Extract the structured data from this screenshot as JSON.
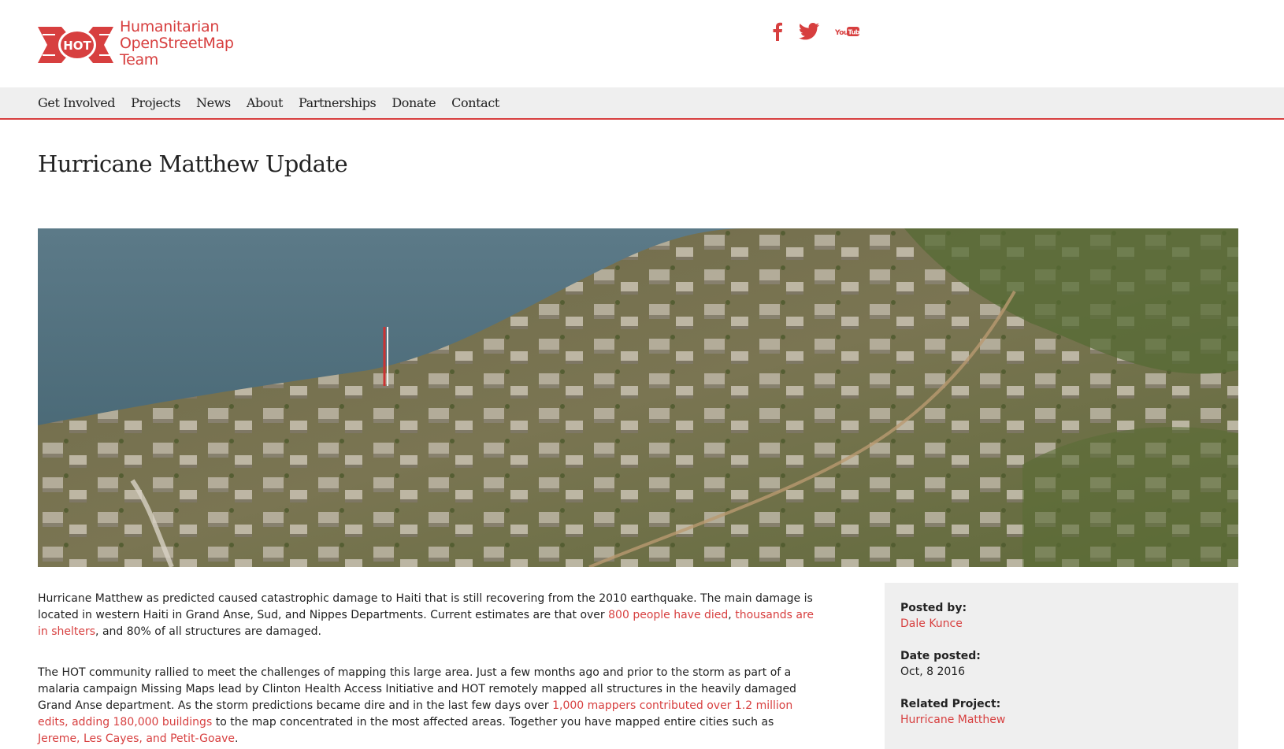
{
  "brand": {
    "mark_text": "HOT",
    "line1": "Humanitarian",
    "line2": "OpenStreetMap",
    "line3": "Team",
    "color": "#d73f3f"
  },
  "social": [
    {
      "icon": "facebook-icon"
    },
    {
      "icon": "twitter-icon"
    },
    {
      "icon": "youtube-icon",
      "text": "YouTube"
    }
  ],
  "nav": {
    "items": [
      "Get Involved",
      "Projects",
      "News",
      "About",
      "Partnerships",
      "Donate",
      "Contact"
    ]
  },
  "page": {
    "title": "Hurricane Matthew Update"
  },
  "article": {
    "p1_a": "Hurricane Matthew as predicted caused catastrophic damage to Haiti that is still recovering from the 2010 earthquake. The main damage is located in western Haiti in Grand Anse, Sud, and Nippes Departments. Current estimates are that over ",
    "p1_link1": "800 people have died",
    "p1_sep": ", ",
    "p1_link2": "thousands are in shelters",
    "p1_b": ", and 80% of all structures are damaged.",
    "p2_a": "The HOT community rallied to meet the challenges of mapping this large area. Just a few months ago and prior to the storm as part of a malaria campaign Missing Maps lead by Clinton Health Access Initiative and HOT remotely mapped all structures in the heavily damaged Grand Anse department. As the storm predictions became dire and in the last few days over ",
    "p2_link1": "1,000 mappers contributed over 1.2 million edits, adding 180,000 buildings",
    "p2_b": " to the map concentrated in the most affected areas. Together you have mapped entire cities such as ",
    "p2_link2": "Jereme, Les Cayes, and Petit-Goave",
    "p2_c": "."
  },
  "sidebar": {
    "posted_by_label": "Posted by:",
    "posted_by": "Dale Kunce",
    "date_label": "Date posted:",
    "date": "Oct, 8 2016",
    "project_label": "Related Project:",
    "project": "Hurricane Matthew"
  },
  "colors": {
    "accent": "#d73f3f",
    "nav_bg": "#efefef"
  }
}
